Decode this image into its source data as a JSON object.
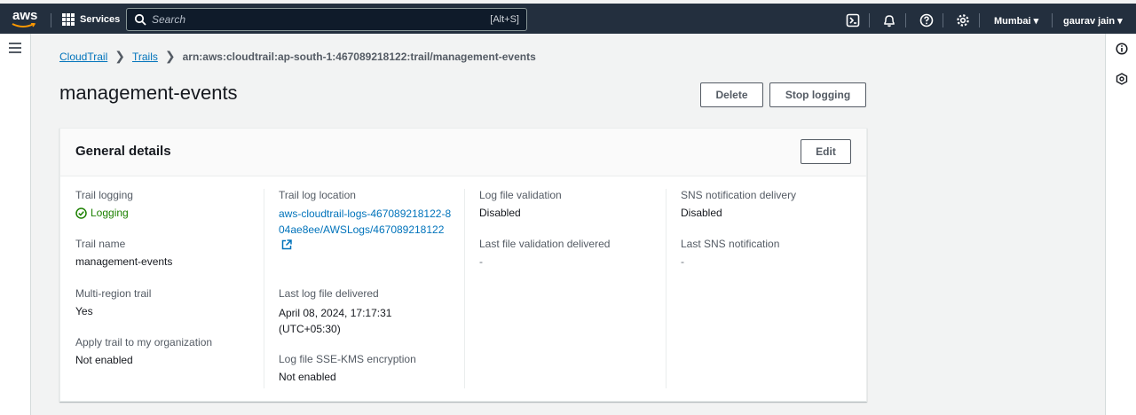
{
  "topnav": {
    "logo_text": "aws",
    "services_label": "Services",
    "search_placeholder": "Search",
    "search_shortcut": "[Alt+S]",
    "region": "Mumbai ▾",
    "user": "gaurav jain ▾",
    "icons": [
      "cloudshell-icon",
      "bell-icon",
      "help-icon",
      "settings-icon"
    ]
  },
  "breadcrumb": {
    "items": [
      "CloudTrail",
      "Trails"
    ],
    "current": "arn:aws:cloudtrail:ap-south-1:467089218122:trail/management-events"
  },
  "page": {
    "title": "management-events",
    "delete_label": "Delete",
    "stop_label": "Stop logging"
  },
  "general": {
    "title": "General details",
    "edit_label": "Edit",
    "trail_logging_label": "Trail logging",
    "trail_logging_value": "Logging",
    "trail_name_label": "Trail name",
    "trail_name_value": "management-events",
    "multi_region_label": "Multi-region trail",
    "multi_region_value": "Yes",
    "apply_org_label": "Apply trail to my organization",
    "apply_org_value": "Not enabled",
    "log_location_label": "Trail log location",
    "log_location_value": "aws-cloudtrail-logs-467089218122-804ae8ee/AWSLogs/467089218122",
    "last_delivered_label": "Last log file delivered",
    "last_delivered_value": "April 08, 2024, 17:17:31 (UTC+05:30)",
    "sse_kms_label": "Log file SSE-KMS encryption",
    "sse_kms_value": "Not enabled",
    "validation_label": "Log file validation",
    "validation_value": "Disabled",
    "last_validation_label": "Last file validation delivered",
    "last_validation_value": "-",
    "sns_label": "SNS notification delivery",
    "sns_value": "Disabled",
    "last_sns_label": "Last SNS notification",
    "last_sns_value": "-"
  },
  "colors": {
    "nav_bg": "#232f3e",
    "link": "#0073bb",
    "success": "#1d8102"
  }
}
